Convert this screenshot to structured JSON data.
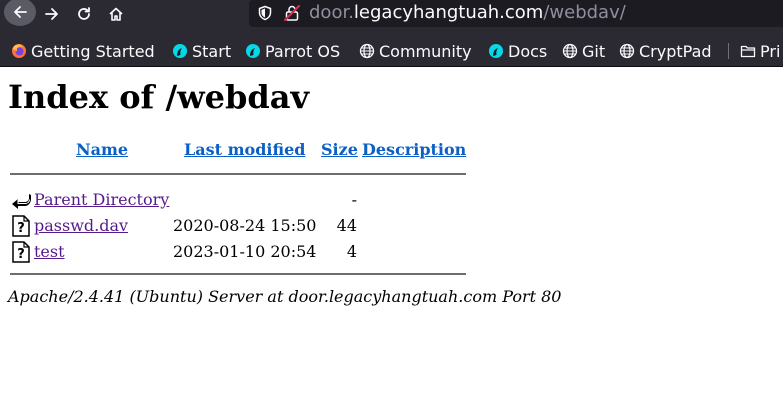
{
  "browser": {
    "url": {
      "subdomain": "door.",
      "host": "legacyhangtuah.com",
      "path": "/webdav/"
    },
    "bookmarks": [
      {
        "label": "Getting Started",
        "icon": "firefox-icon"
      },
      {
        "label": "Start",
        "icon": "parrot-icon"
      },
      {
        "label": "Parrot OS",
        "icon": "parrot-icon"
      },
      {
        "label": "Community",
        "icon": "globe-icon"
      },
      {
        "label": "Docs",
        "icon": "parrot-icon"
      },
      {
        "label": "Git",
        "icon": "globe-icon"
      },
      {
        "label": "CryptPad",
        "icon": "globe-icon"
      },
      {
        "label": "Pri",
        "icon": "folder-icon"
      }
    ]
  },
  "page": {
    "title": "Index of /webdav",
    "columns": {
      "name": "Name",
      "last_modified": "Last modified",
      "size": "Size",
      "description": "Description"
    },
    "rows": [
      {
        "name": "Parent Directory",
        "modified": "",
        "size": "-",
        "icon": "back-icon"
      },
      {
        "name": "passwd.dav",
        "modified": "2020-08-24 15:50",
        "size": "44",
        "icon": "unknown-file-icon"
      },
      {
        "name": "test",
        "modified": "2023-01-10 20:54",
        "size": "4",
        "icon": "unknown-file-icon"
      }
    ],
    "footer": "Apache/2.4.41 (Ubuntu) Server at door.legacyhangtuah.com Port 80"
  }
}
